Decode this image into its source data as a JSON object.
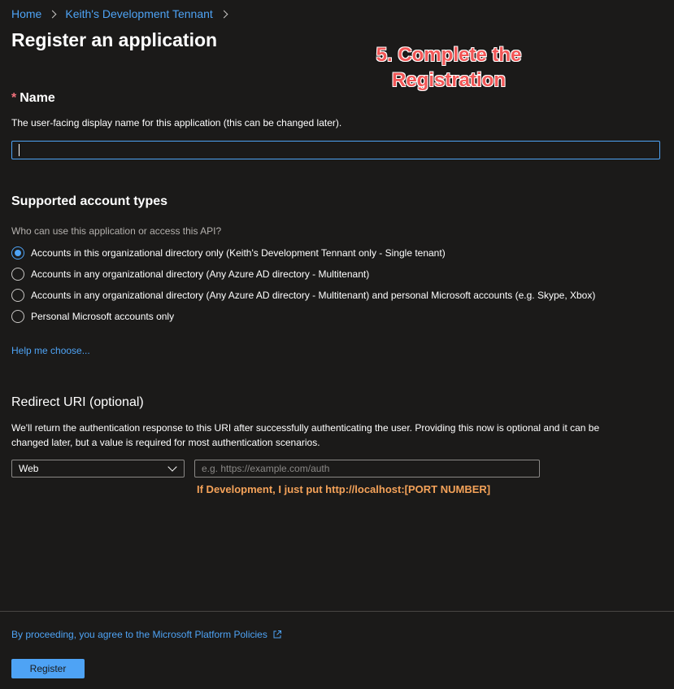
{
  "breadcrumb": {
    "home": "Home",
    "tenant": "Keith's Development Tennant"
  },
  "page_title": "Register an application",
  "annotation": {
    "line1": "5. Complete the",
    "line2": "Registration"
  },
  "name_section": {
    "required_mark": "*",
    "label": "Name",
    "description": "The user-facing display name for this application (this can be changed later).",
    "value": ""
  },
  "account_types": {
    "heading": "Supported account types",
    "question": "Who can use this application or access this API?",
    "options": [
      {
        "label": "Accounts in this organizational directory only (Keith's Development Tennant only - Single tenant)",
        "selected": true
      },
      {
        "label": "Accounts in any organizational directory (Any Azure AD directory - Multitenant)",
        "selected": false
      },
      {
        "label": "Accounts in any organizational directory (Any Azure AD directory - Multitenant) and personal Microsoft accounts (e.g. Skype, Xbox)",
        "selected": false
      },
      {
        "label": "Personal Microsoft accounts only",
        "selected": false
      }
    ],
    "help_link": "Help me choose..."
  },
  "redirect": {
    "heading": "Redirect URI (optional)",
    "description_line1": "We'll return the authentication response to this URI after successfully authenticating the user. Providing this now is optional and it can be",
    "description_line2": "changed later, but a value is required for most authentication scenarios.",
    "platform_selected": "Web",
    "uri_placeholder": "e.g. https://example.com/auth",
    "uri_value": "",
    "note": "If Development, I just put http://localhost:[PORT NUMBER]"
  },
  "footer": {
    "policy_link": "By proceeding, you agree to the Microsoft Platform Policies",
    "register_label": "Register"
  },
  "icons": {
    "breadcrumb_separator": "chevron-right-icon",
    "dropdown": "chevron-down-icon",
    "external_link": "external-link-icon"
  },
  "colors": {
    "background": "#1b1a19",
    "accent": "#4ea3f5",
    "annotation": "#f25757",
    "note": "#f4a259"
  }
}
